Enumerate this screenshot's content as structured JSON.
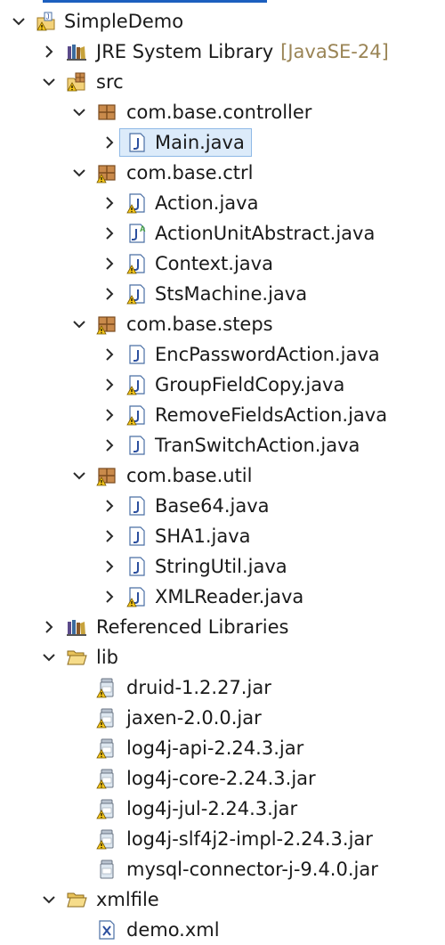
{
  "tree": {
    "project": {
      "label": "SimpleDemo"
    },
    "jre": {
      "label": "JRE System Library",
      "decoration": "[JavaSE-24]"
    },
    "src": {
      "label": "src"
    },
    "pkg_controller": {
      "label": "com.base.controller"
    },
    "file_main": {
      "label": "Main.java"
    },
    "pkg_ctrl": {
      "label": "com.base.ctrl"
    },
    "file_action": {
      "label": "Action.java"
    },
    "file_actionunit": {
      "label": "ActionUnitAbstract.java"
    },
    "file_context": {
      "label": "Context.java"
    },
    "file_stsmachine": {
      "label": "StsMachine.java"
    },
    "pkg_steps": {
      "label": "com.base.steps"
    },
    "file_encpassword": {
      "label": "EncPasswordAction.java"
    },
    "file_groupfield": {
      "label": "GroupFieldCopy.java"
    },
    "file_removefields": {
      "label": "RemoveFieldsAction.java"
    },
    "file_transwitch": {
      "label": "TranSwitchAction.java"
    },
    "pkg_util": {
      "label": "com.base.util"
    },
    "file_base64": {
      "label": "Base64.java"
    },
    "file_sha1": {
      "label": "SHA1.java"
    },
    "file_stringutil": {
      "label": "StringUtil.java"
    },
    "file_xmlreader": {
      "label": "XMLReader.java"
    },
    "reflibs": {
      "label": "Referenced Libraries"
    },
    "lib": {
      "label": "lib"
    },
    "jar_druid": {
      "label": "druid-1.2.27.jar"
    },
    "jar_jaxen": {
      "label": "jaxen-2.0.0.jar"
    },
    "jar_log4j_api": {
      "label": "log4j-api-2.24.3.jar"
    },
    "jar_log4j_core": {
      "label": "log4j-core-2.24.3.jar"
    },
    "jar_log4j_jul": {
      "label": "log4j-jul-2.24.3.jar"
    },
    "jar_log4j_slf4j2": {
      "label": "log4j-slf4j2-impl-2.24.3.jar"
    },
    "jar_mysql": {
      "label": "mysql-connector-j-9.4.0.jar"
    },
    "xmlfile": {
      "label": "xmlfile"
    },
    "file_demo_xml": {
      "label": "demo.xml"
    }
  },
  "icons": {
    "chevron_expanded": "chevron-down-icon",
    "chevron_collapsed": "chevron-right-icon",
    "project": "java-project-icon",
    "library": "library-icon",
    "source_folder": "source-folder-icon",
    "package": "package-icon",
    "java_file": "java-file-icon",
    "abstract_java_file": "abstract-java-file-icon",
    "folder": "folder-icon",
    "jar": "jar-icon",
    "xml_file": "xml-file-icon",
    "warning_overlay": "warning-overlay-icon"
  },
  "colors": {
    "selection_bg": "#dcebfa",
    "selection_border": "#8fb9e6",
    "decoration_text": "#9a8455",
    "accent_line": "#1c5fbf",
    "warning": "#e8b010",
    "package_brown": "#9c6a3a"
  }
}
